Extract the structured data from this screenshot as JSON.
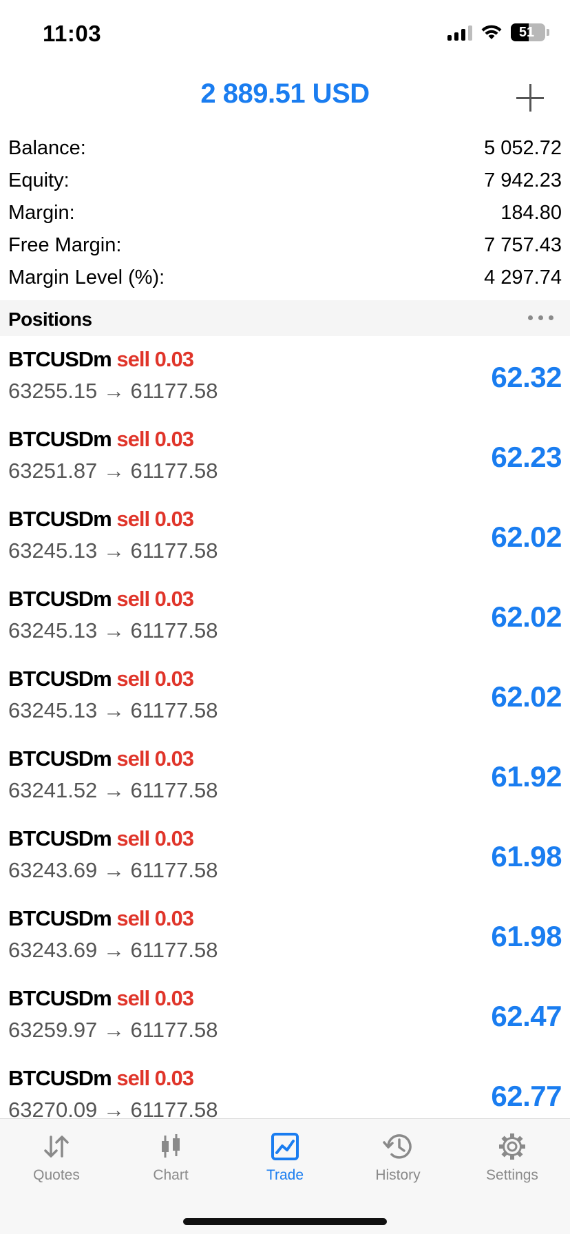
{
  "status_bar": {
    "time": "11:03",
    "battery_level": "51"
  },
  "header": {
    "title": "2 889.51 USD",
    "add_icon": "plus-icon"
  },
  "account": [
    {
      "label": "Balance:",
      "value": "5 052.72"
    },
    {
      "label": "Equity:",
      "value": "7 942.23"
    },
    {
      "label": "Margin:",
      "value": "184.80"
    },
    {
      "label": "Free Margin:",
      "value": "7 757.43"
    },
    {
      "label": "Margin Level (%):",
      "value": "4 297.74"
    }
  ],
  "positions": {
    "title": "Positions",
    "more_icon": "more-horizontal-icon",
    "items": [
      {
        "symbol": "BTCUSDm",
        "type": "sell 0.03",
        "prices": "63255.15 → 61177.58",
        "profit": "62.32"
      },
      {
        "symbol": "BTCUSDm",
        "type": "sell 0.03",
        "prices": "63251.87 → 61177.58",
        "profit": "62.23"
      },
      {
        "symbol": "BTCUSDm",
        "type": "sell 0.03",
        "prices": "63245.13 → 61177.58",
        "profit": "62.02"
      },
      {
        "symbol": "BTCUSDm",
        "type": "sell 0.03",
        "prices": "63245.13 → 61177.58",
        "profit": "62.02"
      },
      {
        "symbol": "BTCUSDm",
        "type": "sell 0.03",
        "prices": "63245.13 → 61177.58",
        "profit": "62.02"
      },
      {
        "symbol": "BTCUSDm",
        "type": "sell 0.03",
        "prices": "63241.52 → 61177.58",
        "profit": "61.92"
      },
      {
        "symbol": "BTCUSDm",
        "type": "sell 0.03",
        "prices": "63243.69 → 61177.58",
        "profit": "61.98"
      },
      {
        "symbol": "BTCUSDm",
        "type": "sell 0.03",
        "prices": "63243.69 → 61177.58",
        "profit": "61.98"
      },
      {
        "symbol": "BTCUSDm",
        "type": "sell 0.03",
        "prices": "63259.97 → 61177.58",
        "profit": "62.47"
      },
      {
        "symbol": "BTCUSDm",
        "type": "sell 0.03",
        "prices": "63270.09 → 61177.58",
        "profit": "62.77"
      }
    ]
  },
  "tabs": [
    {
      "label": "Quotes",
      "icon": "quotes-arrows-icon",
      "active": false
    },
    {
      "label": "Chart",
      "icon": "candlestick-chart-icon",
      "active": false
    },
    {
      "label": "Trade",
      "icon": "trade-chart-icon",
      "active": true
    },
    {
      "label": "History",
      "icon": "history-clock-icon",
      "active": false
    },
    {
      "label": "Settings",
      "icon": "gear-icon",
      "active": false
    }
  ],
  "colors": {
    "accent": "#1a7df0",
    "sell": "#e0352a",
    "inactive_tab": "#8a8a8a"
  }
}
